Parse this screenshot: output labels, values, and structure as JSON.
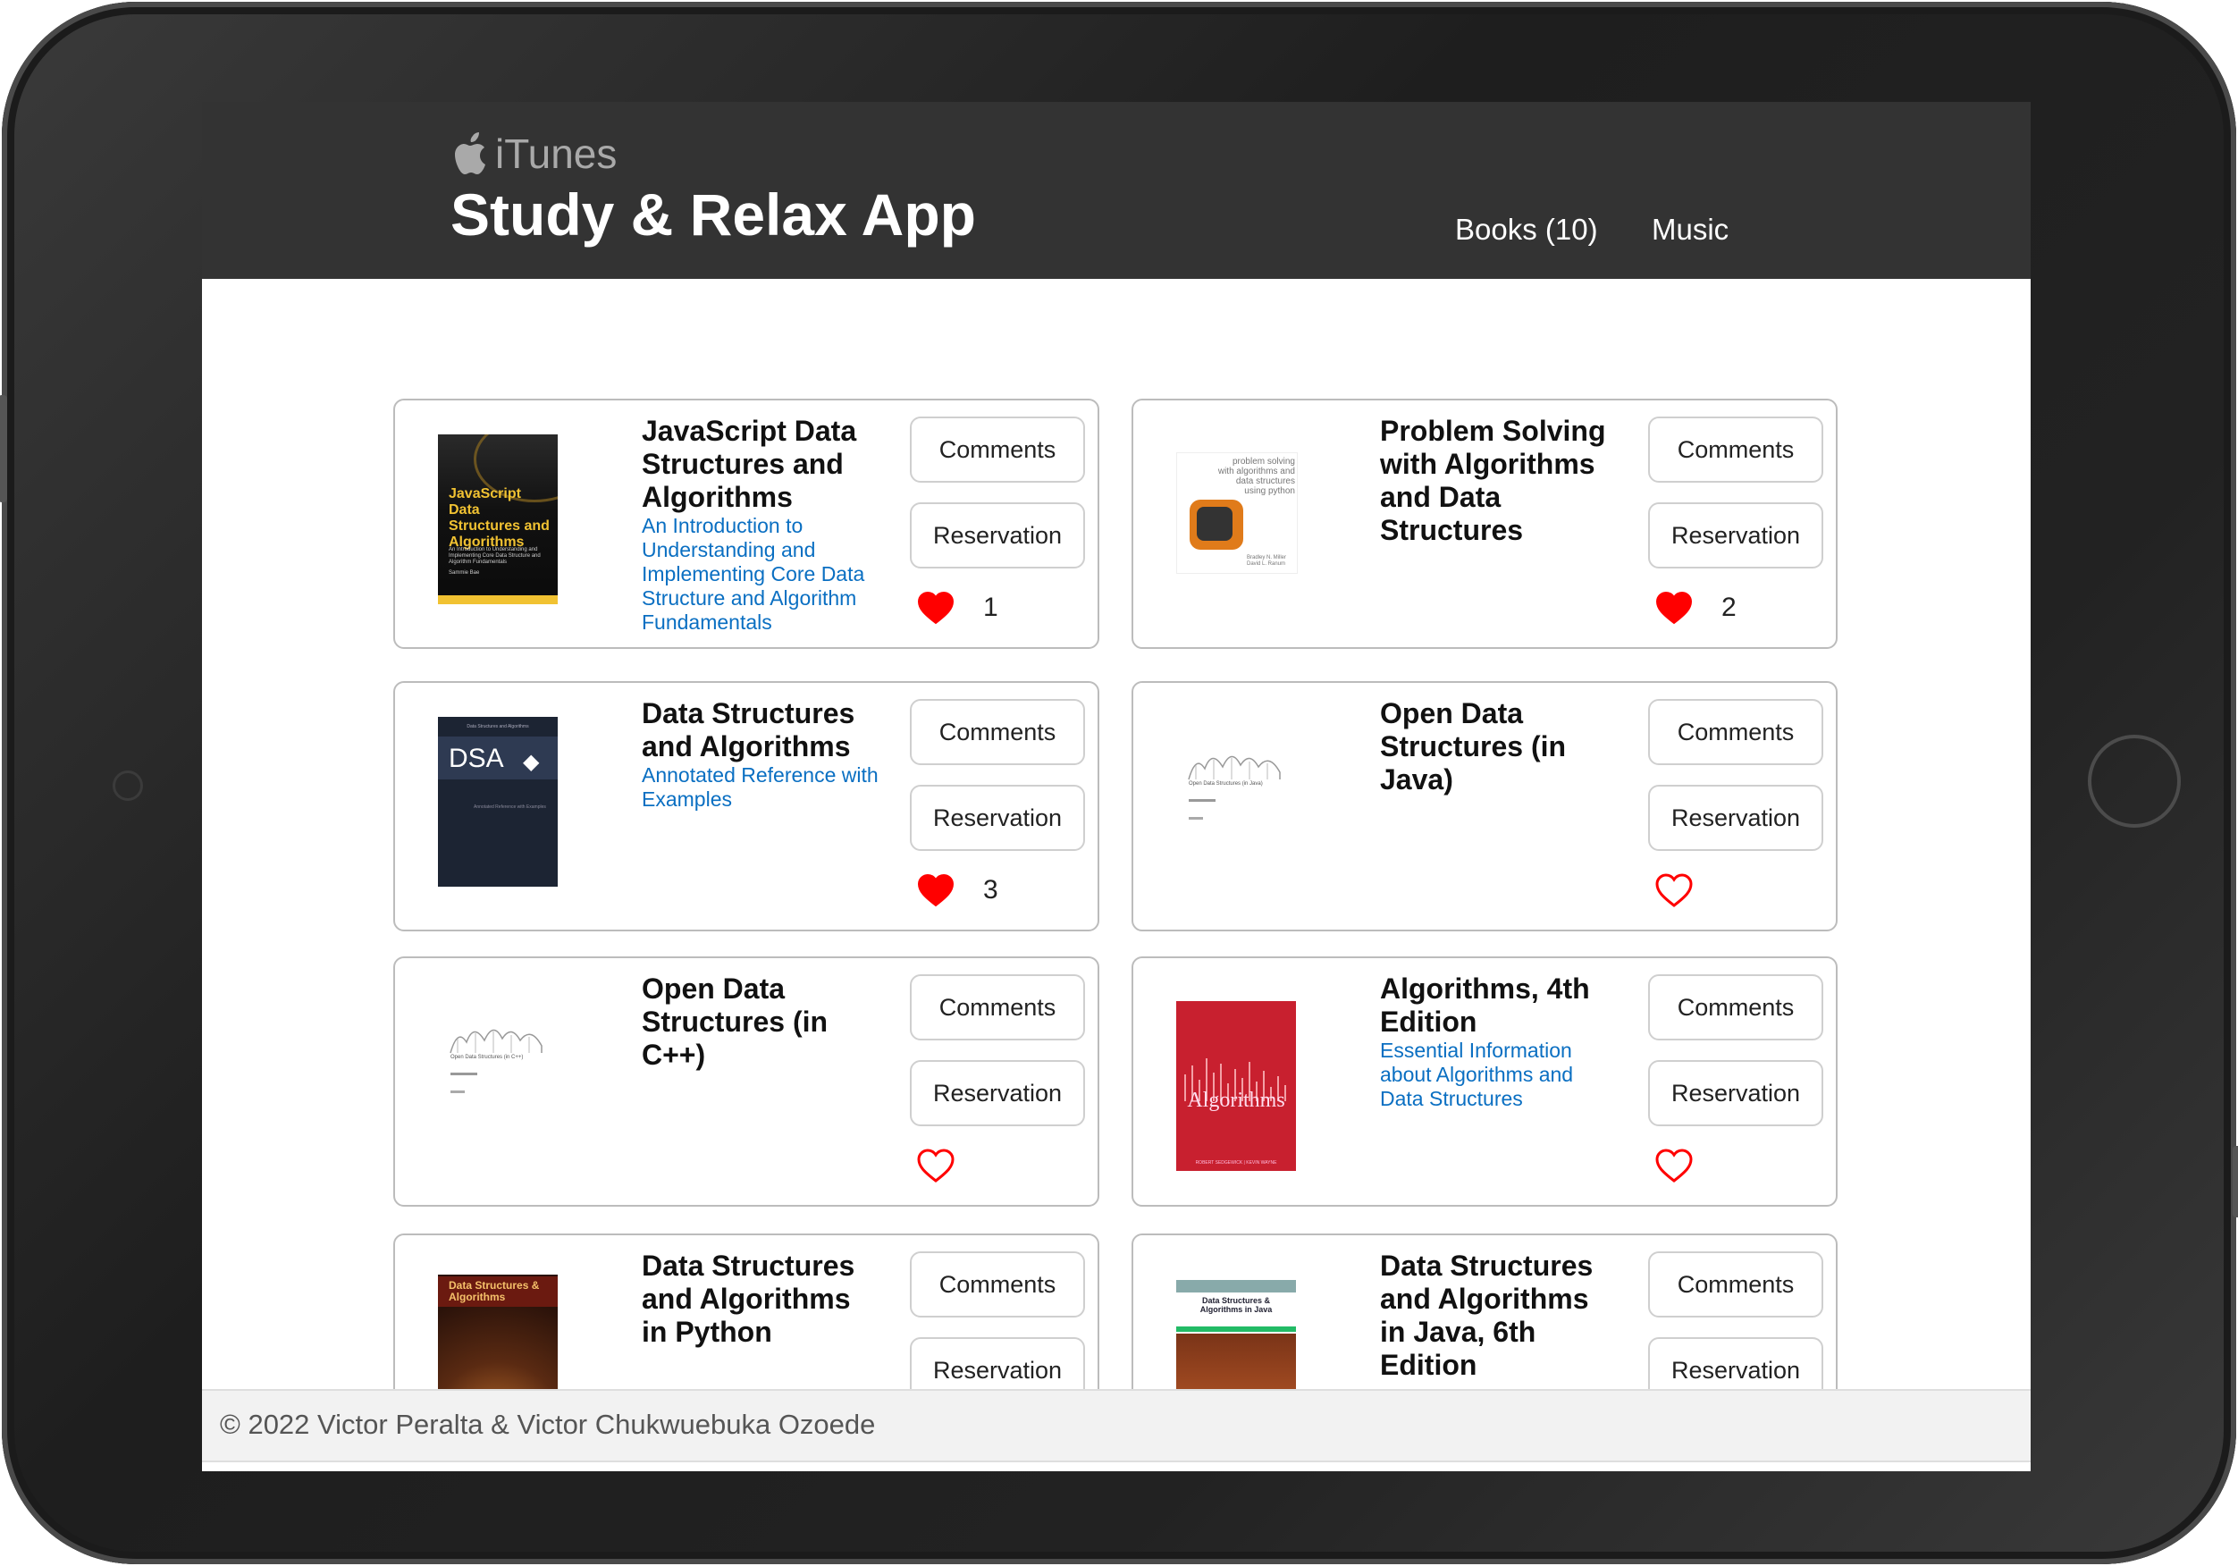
{
  "brand": {
    "name": "iTunes",
    "icon": "apple-logo-icon"
  },
  "app_title": "Study & Relax App",
  "nav": {
    "books": "Books (10)",
    "music": "Music"
  },
  "labels": {
    "comments": "Comments",
    "reservation": "Reservation"
  },
  "books": [
    {
      "title": "JavaScript Data Structures and Algorithms",
      "subtitle": "An Introduction to Understanding and Implementing Core Data Structure and Algorithm Fundamentals",
      "liked": true,
      "likes": "1",
      "cover": {
        "text": "JavaScript Data Structures and Algorithms",
        "subtext": "An Introduction to Understanding and Implementing Core Data Structure and Algorithm Fundamentals",
        "author": "Sammie Bae"
      }
    },
    {
      "title": "Problem Solving with Algorithms and Data Structures",
      "subtitle": "",
      "liked": true,
      "likes": "2",
      "cover": {
        "text": "problem solving with algorithms and data structures using python",
        "author": "Bradley N. Miller David L. Ranum"
      }
    },
    {
      "title": "Data Structures and Algorithms",
      "subtitle": "Annotated Reference with Examples",
      "liked": true,
      "likes": "3",
      "cover": {
        "text": "DSA",
        "top": "Data Structures and Algorithms",
        "mid": "Annotated Reference with Examples"
      }
    },
    {
      "title": "Open Data Structures (in Java)",
      "subtitle": "",
      "liked": false,
      "likes": "",
      "cover": {
        "text": "Open Data Structures (in Java)"
      }
    },
    {
      "title": "Open Data Structures (in C++)",
      "subtitle": "",
      "liked": false,
      "likes": "",
      "cover": {
        "text": "Open Data Structures (in C++)"
      }
    },
    {
      "title": "Algorithms, 4th Edition",
      "subtitle": "Essential Information about Algorithms and Data Structures",
      "liked": false,
      "likes": "",
      "cover": {
        "text": "Algorithms",
        "author": "ROBERT SEDGEWICK | KEVIN WAYNE"
      }
    },
    {
      "title": "Data Structures and Algorithms in Python",
      "subtitle": "",
      "liked": false,
      "likes": "",
      "cover": {
        "text": "Data Structures & Algorithms"
      }
    },
    {
      "title": "Data Structures and Algorithms in Java, 6th Edition",
      "subtitle": "",
      "liked": false,
      "likes": "",
      "cover": {
        "text": "Data Structures & Algorithms in Java"
      }
    }
  ],
  "footer": "© 2022 Victor Peralta & Victor Chukwuebuka Ozoede",
  "colors": {
    "header_bg": "#333333",
    "link": "#0a6fc2",
    "heart": "#ff0000"
  }
}
